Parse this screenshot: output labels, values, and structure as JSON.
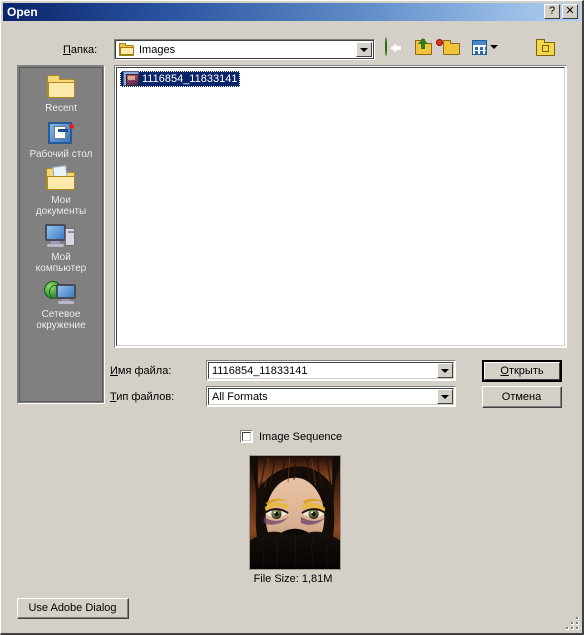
{
  "window": {
    "title": "Open",
    "help_button": "?",
    "close_button": "✕"
  },
  "lookin": {
    "label_prefix": "П",
    "label_rest": "апка:",
    "label_full": "Папка:",
    "value": "Images",
    "folder_icon": "folder-icon",
    "dropdown_icon": "chevron-down-icon"
  },
  "toolbar": {
    "items": [
      {
        "name": "back-button",
        "icon": "back-arrow-icon"
      },
      {
        "name": "up-one-level-button",
        "icon": "up-folder-icon"
      },
      {
        "name": "create-new-folder-button",
        "icon": "new-folder-icon"
      },
      {
        "name": "views-button",
        "icon": "views-icon"
      }
    ],
    "tools_button": {
      "name": "tools-button",
      "icon": "tools-folder-icon"
    }
  },
  "places": {
    "items": [
      {
        "label": "Recent",
        "icon": "recent-folder-icon"
      },
      {
        "label": "Рабочий стол",
        "icon": "desktop-icon"
      },
      {
        "label": "Мои\nдокументы",
        "icon": "my-documents-icon"
      },
      {
        "label": "Мой\nкомпьютер",
        "icon": "my-computer-icon"
      },
      {
        "label": "Сетевое\nокружение",
        "icon": "network-places-icon"
      }
    ]
  },
  "filelist": {
    "files": [
      {
        "name": "1116854_11833141",
        "icon": "image-file-icon",
        "selected": true
      }
    ]
  },
  "fields": {
    "name_label_accel": "И",
    "name_label_rest": "мя файла:",
    "name_label_full": "Имя файла:",
    "name_value": "1116854_11833141",
    "type_label_accel": "Т",
    "type_label_rest": "ип файлов:",
    "type_label_full": "Тип файлов:",
    "type_value": "All Formats"
  },
  "buttons": {
    "open_accel": "О",
    "open_rest": "ткрыть",
    "open_full": "Открыть",
    "cancel": "Отмена",
    "use_adobe_dialog": "Use Adobe Dialog"
  },
  "options": {
    "image_sequence_label": "Image Sequence",
    "image_sequence_checked": false
  },
  "preview": {
    "file_size_text": "File Size: 1,81M",
    "image_description": "portrait of a woman with dark hair, gold and purple eye makeup, wearing a black veil over the lower face"
  },
  "colors": {
    "dialog_face": "#d4d0c8",
    "title_gradient_start": "#0a246a",
    "title_gradient_end": "#b0cdec",
    "places_bar": "#808080",
    "selection": "#0a246a",
    "list_background": "#ffffff"
  }
}
